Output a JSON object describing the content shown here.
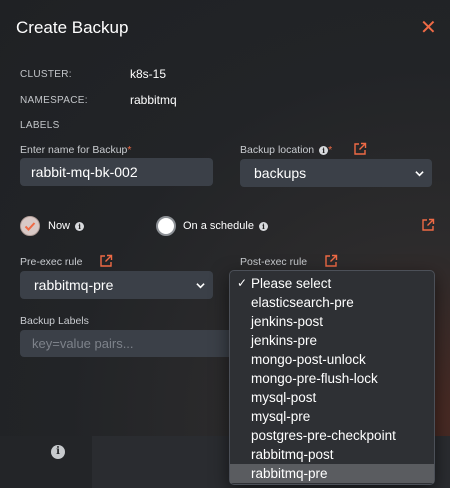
{
  "dialog": {
    "title": "Create Backup",
    "close_glyph": "✕"
  },
  "info": {
    "cluster_label": "CLUSTER:",
    "cluster_value": "k8s-15",
    "namespace_label": "NAMESPACE:",
    "namespace_value": "rabbitmq",
    "labels_label": "LABELS"
  },
  "form": {
    "name_label": "Enter name for Backup",
    "name_value": "rabbit-mq-bk-002",
    "location_label": "Backup location",
    "location_value": "backups",
    "required_mark": "*",
    "schedule": {
      "now_label": "Now",
      "on_schedule_label": "On a schedule",
      "selected": "Now"
    },
    "pre_exec_label": "Pre-exec rule",
    "pre_exec_value": "rabbitmq-pre",
    "post_exec_label": "Post-exec rule",
    "backup_labels_label": "Backup Labels",
    "backup_labels_placeholder": "key=value pairs..."
  },
  "post_exec_menu": {
    "checked_index": 0,
    "highlighted_index": 10,
    "check_glyph": "✓",
    "options": [
      "Please select",
      "elasticsearch-pre",
      "jenkins-post",
      "jenkins-pre",
      "mongo-post-unlock",
      "mongo-pre-flush-lock",
      "mysql-post",
      "mysql-pre",
      "postgres-pre-checkpoint",
      "rabbitmq-post",
      "rabbitmq-pre"
    ]
  },
  "icons": {
    "close": "close-icon",
    "external": "external-link-icon",
    "info": "info-icon",
    "chevron": "chevron-down-icon",
    "check": "checkmark-icon"
  },
  "colors": {
    "accent": "#ef6a45",
    "background": "#222427",
    "input_bg": "#3b4048",
    "menu_bg": "#2e3034",
    "menu_highlight": "#5a5c60"
  }
}
